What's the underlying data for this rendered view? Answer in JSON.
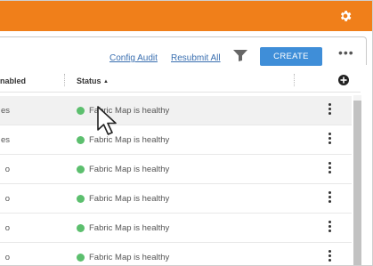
{
  "colors": {
    "topbar": "#f07f1a",
    "create_button": "#3f8ed8",
    "link": "#3a6fb0",
    "status_dot": "#5cbf6e"
  },
  "topbar": {
    "settings_icon": "gear-icon"
  },
  "toolbar": {
    "config_audit_label": "Config Audit",
    "resubmit_all_label": "Resubmit All",
    "filter_icon": "filter-icon",
    "create_label": "CREATE",
    "more_icon": "more-horizontal-icon"
  },
  "table": {
    "columns": {
      "enabled_label": "nabled",
      "status_label": "Status",
      "status_sort": "ascending"
    },
    "add_column_icon": "plus-circle-icon",
    "rows": [
      {
        "enabled": "es",
        "status": "Fabric Map is healthy",
        "status_color": "green"
      },
      {
        "enabled": "es",
        "status": "Fabric Map is healthy",
        "status_color": "green"
      },
      {
        "enabled": "o",
        "status": "Fabric Map is healthy",
        "status_color": "green"
      },
      {
        "enabled": "o",
        "status": "Fabric Map is healthy",
        "status_color": "green"
      },
      {
        "enabled": "o",
        "status": "Fabric Map is healthy",
        "status_color": "green"
      },
      {
        "enabled": "o",
        "status": "Fabric Map is healthy",
        "status_color": "green"
      }
    ]
  }
}
